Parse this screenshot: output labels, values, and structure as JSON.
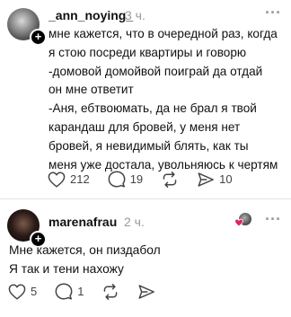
{
  "posts": [
    {
      "username": "_ann_noying_",
      "time": "3 ч.",
      "text": "мне кажется, что в очередной раз, когда\nя стою посреди квартиры и говорю\n-домовой домойвой поиграй да отдай\nон мне ответит\n-Аня, ебтвоюмать, да не брал я твой\nкарандаш для бровей, у меня нет\nбровей, я невидимый блять, как ты\nменя уже достала, увольняюсь к чертям",
      "likes": "212",
      "replies": "19",
      "reposts": "",
      "shares": "10"
    },
    {
      "username": "marenafrau",
      "time": "2 ч.",
      "text": "Мне кажется, он пиздабол\nЯ так и тени нахожу",
      "likes": "5",
      "replies": "1",
      "reposts": "",
      "shares": ""
    }
  ],
  "icons": {
    "more": "more-icon",
    "like": "heart-icon",
    "reply": "comment-icon",
    "repost": "repost-icon",
    "share": "send-icon",
    "follow": "plus-icon"
  },
  "colors": {
    "text": "#111111",
    "muted": "#9a9a9a",
    "icon": "#444444",
    "heart_badge": "#e0245e"
  }
}
